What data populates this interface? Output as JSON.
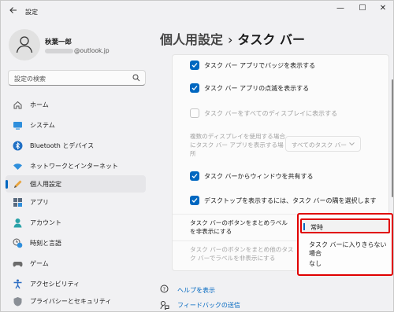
{
  "window": {
    "title": "設定",
    "minimize": "—",
    "maximize": "☐",
    "close": "✕"
  },
  "user": {
    "name": "秋葉一郎",
    "email_domain": "@outlook.jp"
  },
  "search": {
    "placeholder": "設定の検索"
  },
  "sidebar": {
    "items": [
      {
        "label": "ホーム",
        "icon": "home-icon"
      },
      {
        "label": "システム",
        "icon": "monitor-icon"
      },
      {
        "label": "Bluetooth とデバイス",
        "icon": "bluetooth-icon"
      },
      {
        "label": "ネットワークとインターネット",
        "icon": "wifi-icon"
      },
      {
        "label": "個人用設定",
        "icon": "pen-icon",
        "selected": true
      },
      {
        "label": "アプリ",
        "icon": "apps-icon"
      },
      {
        "label": "アカウント",
        "icon": "account-icon"
      },
      {
        "label": "時刻と言語",
        "icon": "clock-globe-icon"
      },
      {
        "label": "ゲーム",
        "icon": "gamepad-icon"
      },
      {
        "label": "アクセシビリティ",
        "icon": "accessibility-icon"
      },
      {
        "label": "プライバシーとセキュリティ",
        "icon": "shield-icon"
      }
    ]
  },
  "page": {
    "breadcrumb_parent": "個人用設定",
    "separator": "›",
    "title": "タスク バー"
  },
  "settings": {
    "badges": "タスク バー アプリでバッジを表示する",
    "flashing": "タスク バー アプリの点滅を表示する",
    "all_displays": "タスク バーをすべてのディスプレイに表示する",
    "multi_display_label": "複数のディスプレイを使用する場合にタスク バー アプリを表示する場所",
    "multi_display_value": "すべてのタスク バー",
    "share_window": "タスク バーからウィンドウを共有する",
    "desktop_corner": "デスクトップを表示するには、タスク バーの隅を選択します",
    "combine_label": "タスク バーのボタンをまとめラベルを非表示にする",
    "combine_other_label": "タスク バーのボタンをまとめ他のタスク バーでラベルを非表示にする"
  },
  "dropdown": {
    "options": [
      "常時",
      "タスク バーに入りきらない場合",
      "なし"
    ],
    "selected": "常時"
  },
  "links": {
    "help": "ヘルプを表示",
    "feedback": "フィードバックの送信"
  },
  "colors": {
    "accent": "#0067c0",
    "highlight_border": "#e00000"
  }
}
